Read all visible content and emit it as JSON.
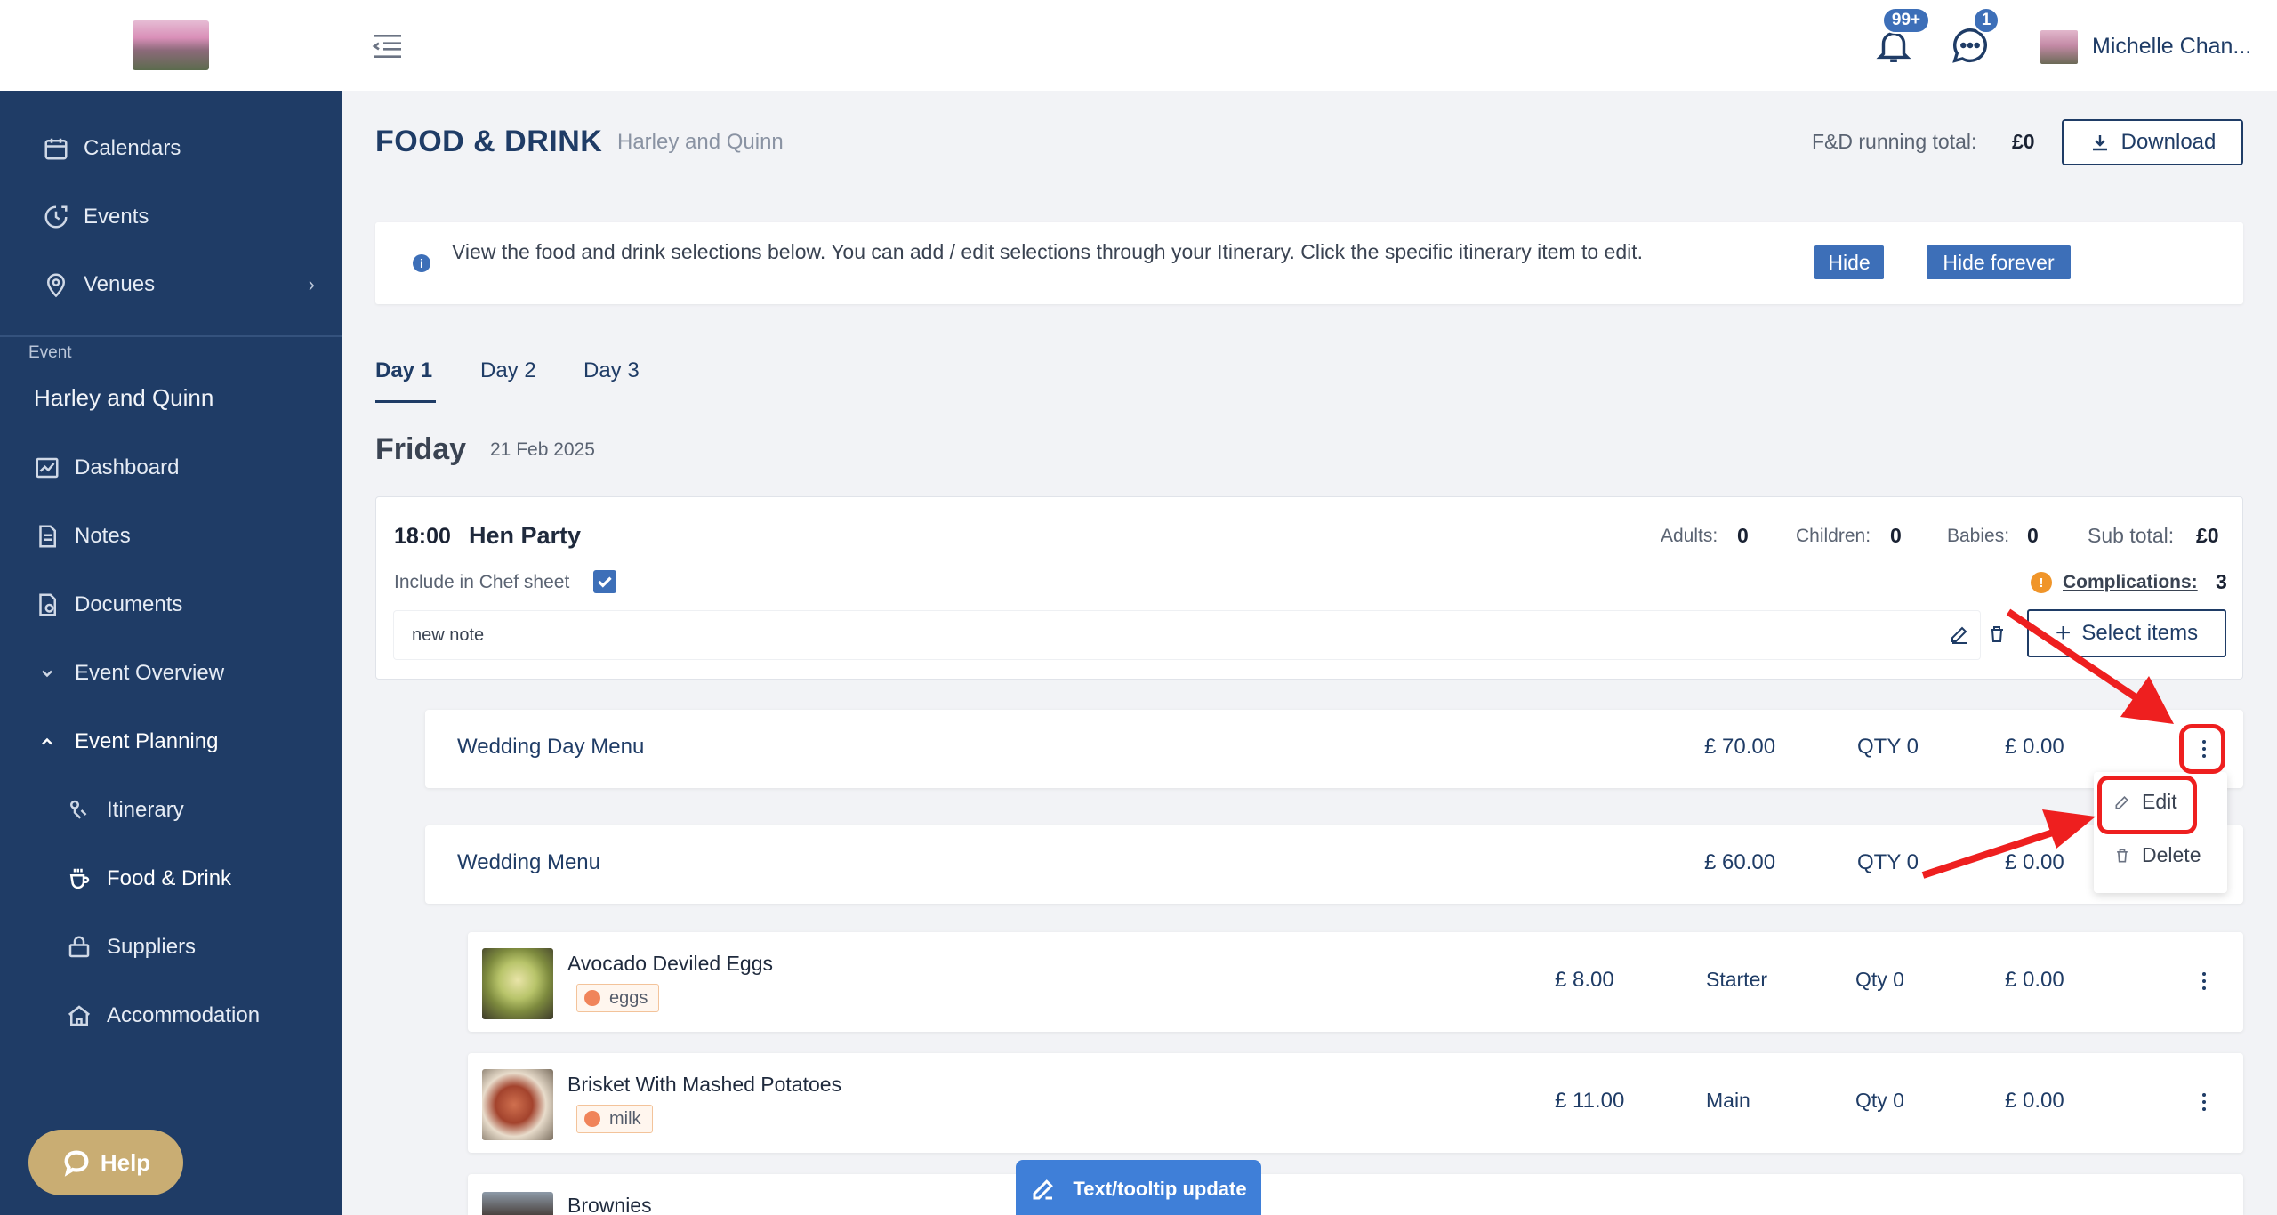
{
  "sidebar": {
    "nav": [
      {
        "label": "Calendars",
        "icon": "calendar-icon"
      },
      {
        "label": "Events",
        "icon": "events-icon"
      },
      {
        "label": "Venues",
        "icon": "location-pin-icon"
      }
    ],
    "event_caption": "Event",
    "event_name": "Harley and Quinn",
    "event_nav": [
      {
        "label": "Dashboard",
        "icon": "chart-icon"
      },
      {
        "label": "Notes",
        "icon": "note-icon"
      },
      {
        "label": "Documents",
        "icon": "document-icon"
      },
      {
        "label": "Event Overview",
        "icon": "chevron-down-icon"
      },
      {
        "label": "Event Planning",
        "icon": "chevron-up-icon"
      },
      {
        "label": "Itinerary",
        "icon": "itinerary-icon"
      },
      {
        "label": "Food & Drink",
        "icon": "cup-icon"
      },
      {
        "label": "Suppliers",
        "icon": "suppliers-icon"
      },
      {
        "label": "Accommodation",
        "icon": "home-icon"
      }
    ],
    "help_label": "Help"
  },
  "topbar": {
    "notifications_badge": "99+",
    "messages_badge": "1",
    "user_name": "Michelle Chan..."
  },
  "header": {
    "title": "FOOD & DRINK",
    "subtitle": "Harley and Quinn",
    "running_total_label": "F&D running total:",
    "running_total_value": "£0",
    "download_label": "Download"
  },
  "info": {
    "text": "View the food and drink selections below. You can add / edit selections through your Itinerary. Click the specific itinerary item to edit.",
    "hide_label": "Hide",
    "hide_forever_label": "Hide forever"
  },
  "tabs": [
    "Day 1",
    "Day 2",
    "Day 3"
  ],
  "day": {
    "title": "Friday",
    "date": "21 Feb 2025"
  },
  "session": {
    "time": "18:00",
    "name": "Hen Party",
    "adults_label": "Adults:",
    "adults": "0",
    "children_label": "Children:",
    "children": "0",
    "babies_label": "Babies:",
    "babies": "0",
    "subtotal_label": "Sub total:",
    "subtotal": "£0",
    "chef_sheet_label": "Include in Chef sheet",
    "chef_sheet_checked": true,
    "complications_label": "Complications:",
    "complications": "3",
    "note": "new note",
    "select_items_label": "Select items"
  },
  "menus": [
    {
      "name": "Wedding Day Menu",
      "price": "£ 70.00",
      "qty": "QTY 0",
      "total": "£ 0.00"
    },
    {
      "name": "Wedding Menu",
      "price": "£ 60.00",
      "qty": "QTY 0",
      "total": "£ 0.00"
    }
  ],
  "dropdown": {
    "edit_label": "Edit",
    "delete_label": "Delete"
  },
  "items": [
    {
      "name": "Avocado Deviled Eggs",
      "allergen": "eggs",
      "price": "£ 8.00",
      "course": "Starter",
      "qty": "Qty 0",
      "total": "£ 0.00"
    },
    {
      "name": "Brisket With Mashed Potatoes",
      "allergen": "milk",
      "price": "£ 11.00",
      "course": "Main",
      "qty": "Qty 0",
      "total": "£ 0.00"
    },
    {
      "name": "Brownies"
    }
  ],
  "tooltip_button": "Text/tooltip update",
  "colors": {
    "brand_navy": "#1f3c66",
    "accent_blue": "#3d6fb8",
    "help_gold": "#c9ad73",
    "annotation_red": "#ee1f1f",
    "warning_orange": "#f0952a"
  }
}
